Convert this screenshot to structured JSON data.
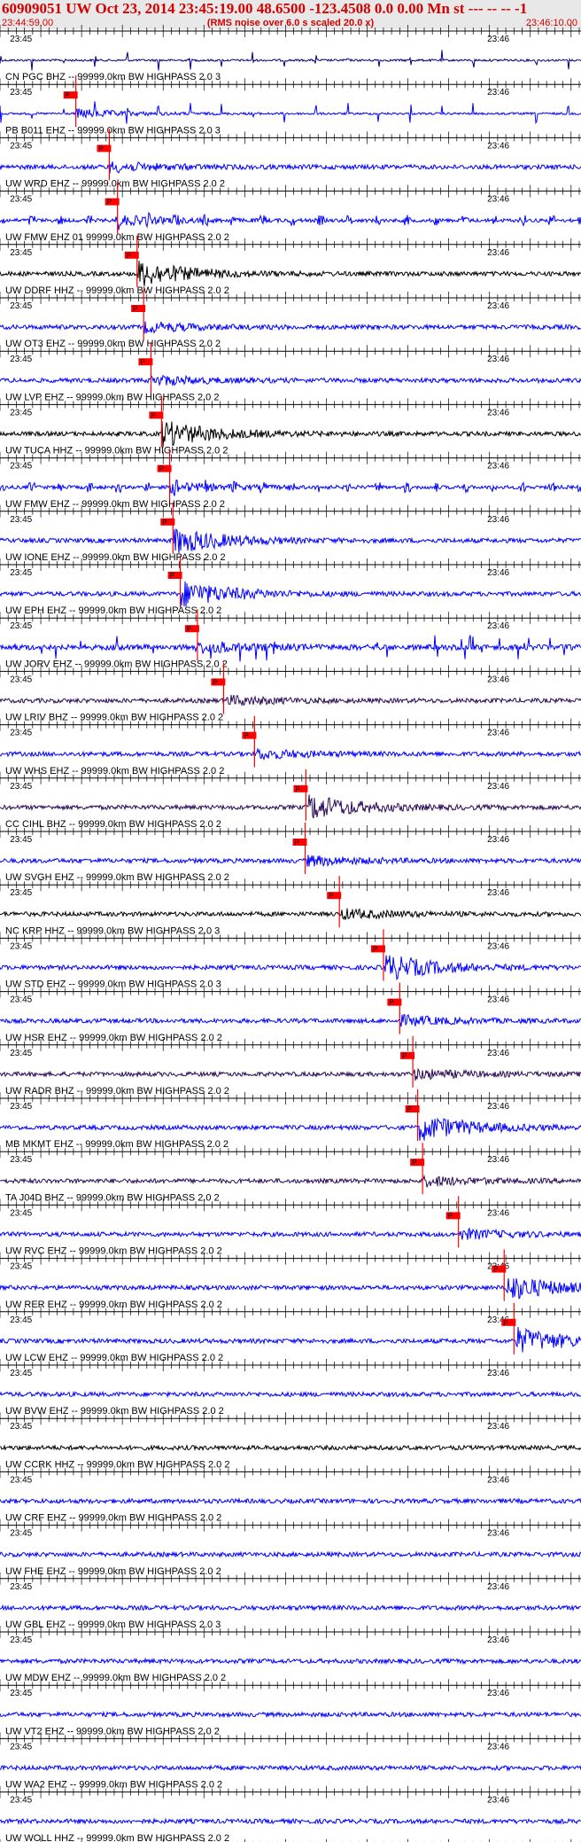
{
  "header": {
    "title": "60909051 UW Oct 23, 2014 23:45:19.00   48.6500 -123.4508  0.0 0.00 Mn st --- -- --   -1",
    "start_time": "23:44:59.00",
    "end_time": "23:46:10.00",
    "rms_note": "(RMS noise over 6.0 s scaled 20.0 x)"
  },
  "colors": {
    "title": "#d40000",
    "pick": "#ff0000",
    "blue_trace": "#0000ff",
    "black_trace": "#000000",
    "purple_trace": "#2a0a55"
  },
  "chart_data": {
    "type": "line",
    "time_range_s": [
      0,
      71
    ],
    "time_ticks": [
      "23:45",
      "23:46"
    ],
    "pick_label": "P",
    "traces": [
      {
        "label": "",
        "color": "#000080",
        "pick_s": null,
        "style": "pulse"
      },
      {
        "label": "CN PGC BHZ -- 99999.0km BW  HIGHPASS  2.0  3",
        "color": "#0000ff",
        "pick_s": 9.3,
        "style": "pulse"
      },
      {
        "label": "PB B011 EHZ -- 99999.0km BW  HIGHPASS  2.0  3",
        "color": "#0000ff",
        "pick_s": 13.4,
        "style": "noise"
      },
      {
        "label": "UW WRD EHZ -- 99999.0km BW  HIGHPASS  2.0  2",
        "color": "#0000ff",
        "pick_s": 14.4,
        "style": "bursts"
      },
      {
        "label": "UW FMW EHZ 01 99999.0km BW  HIGHPASS  2.0  2",
        "color": "#000000",
        "pick_s": 16.8,
        "style": "event"
      },
      {
        "label": "UW DDRF HHZ -- 99999.0km BW  HIGHPASS  2.0  2",
        "color": "#0000ff",
        "pick_s": 17.6,
        "style": "noise"
      },
      {
        "label": "UW OT3 EHZ -- 99999.0km BW  HIGHPASS  2.0  2",
        "color": "#0000ff",
        "pick_s": 18.5,
        "style": "noise"
      },
      {
        "label": "UW LVP EHZ -- 99999.0km BW  HIGHPASS  2.0  2",
        "color": "#000000",
        "pick_s": 19.8,
        "style": "event"
      },
      {
        "label": "UW TUCA HHZ -- 99999.0km BW  HIGHPASS  2.0  2",
        "color": "#0000ff",
        "pick_s": 20.8,
        "style": "bursts"
      },
      {
        "label": "UW FMW EHZ -- 99999.0km BW  HIGHPASS  2.0  2",
        "color": "#0000ff",
        "pick_s": 21.2,
        "style": "event"
      },
      {
        "label": "UW IONE EHZ -- 99999.0km BW  HIGHPASS  2.0  2",
        "color": "#0000ff",
        "pick_s": 22.1,
        "style": "event"
      },
      {
        "label": "UW EPH EHZ -- 99999.0km BW  HIGHPASS  2.0  2",
        "color": "#0000ff",
        "pick_s": 24.2,
        "style": "spiky"
      },
      {
        "label": "UW JORV EHZ -- 99999.0km BW  HIGHPASS  2.0  2",
        "color": "#2a0a55",
        "pick_s": 27.4,
        "style": "noise"
      },
      {
        "label": "UW LRIV BHZ -- 99999.0km BW  HIGHPASS  2.0  2",
        "color": "#0000ff",
        "pick_s": 31.2,
        "style": "noise"
      },
      {
        "label": "UW WHS EHZ -- 99999.0km BW  HIGHPASS  2.0  2",
        "color": "#2a0a55",
        "pick_s": 37.5,
        "style": "event"
      },
      {
        "label": "CC CIHL BHZ -- 99999.0km BW  HIGHPASS  2.0  2",
        "color": "#0000ff",
        "pick_s": 37.4,
        "style": "noise"
      },
      {
        "label": "UW SVGH EHZ -- 99999.0km BW  HIGHPASS  2.0  2",
        "color": "#000000",
        "pick_s": 41.6,
        "style": "noise"
      },
      {
        "label": "NC KRP HHZ -- 99999.0km BW  HIGHPASS  2.0  3",
        "color": "#0000ff",
        "pick_s": 47.0,
        "style": "event"
      },
      {
        "label": "UW STD EHZ -- 99999.0km BW  HIGHPASS  2.0  3",
        "color": "#0000ff",
        "pick_s": 49.0,
        "style": "noise"
      },
      {
        "label": "UW HSR EHZ -- 99999.0km BW  HIGHPASS  2.0  2",
        "color": "#2a0a55",
        "pick_s": 50.6,
        "style": "noise"
      },
      {
        "label": "UW RADR BHZ -- 99999.0km BW  HIGHPASS  2.0  2",
        "color": "#0000ff",
        "pick_s": 51.2,
        "style": "event"
      },
      {
        "label": "MB MKMT EHZ -- 99999.0km BW  HIGHPASS  2.0  2",
        "color": "#2a0a55",
        "pick_s": 51.8,
        "style": "noise"
      },
      {
        "label": "TA J04D BHZ -- 99999.0km BW  HIGHPASS  2.0  2",
        "color": "#0000ff",
        "pick_s": 56.2,
        "style": "noise"
      },
      {
        "label": "UW RVC EHZ -- 99999.0km BW  HIGHPASS  2.0  2",
        "color": "#0000ff",
        "pick_s": 61.8,
        "style": "event"
      },
      {
        "label": "UW RER EHZ -- 99999.0km BW  HIGHPASS  2.0  2",
        "color": "#0000ff",
        "pick_s": 63.0,
        "style": "event"
      },
      {
        "label": "UW LCW EHZ -- 99999.0km BW  HIGHPASS  2.0  2",
        "color": "#0000ff",
        "pick_s": null,
        "style": "noise"
      },
      {
        "label": "UW BVW EHZ -- 99999.0km BW  HIGHPASS  2.0  2",
        "color": "#000000",
        "pick_s": null,
        "style": "noise"
      },
      {
        "label": "UW CCRK HHZ -- 99999.0km BW  HIGHPASS  2.0  2",
        "color": "#0000ff",
        "pick_s": null,
        "style": "noise"
      },
      {
        "label": "UW CRF EHZ -- 99999.0km BW  HIGHPASS  2.0  2",
        "color": "#0000ff",
        "pick_s": null,
        "style": "noise"
      },
      {
        "label": "UW FHE EHZ -- 99999.0km BW  HIGHPASS  2.0  2",
        "color": "#0000ff",
        "pick_s": null,
        "style": "noise"
      },
      {
        "label": "UW GBL EHZ -- 99999.0km BW  HIGHPASS  2.0  3",
        "color": "#0000ff",
        "pick_s": null,
        "style": "noise"
      },
      {
        "label": "UW MDW EHZ -- 99999.0km BW  HIGHPASS  2.0  2",
        "color": "#0000ff",
        "pick_s": null,
        "style": "noise"
      },
      {
        "label": "UW VT2 EHZ -- 99999.0km BW  HIGHPASS  2.0  2",
        "color": "#0000ff",
        "pick_s": null,
        "style": "noise"
      },
      {
        "label": "UW WA2 EHZ -- 99999.0km BW  HIGHPASS  2.0  2",
        "color": "#0000ff",
        "pick_s": null,
        "style": "noise"
      },
      {
        "label": "UW WOLL HHZ -- 99999.0km BW  HIGHPASS  2.0  2",
        "color": "#000000",
        "pick_s": null,
        "style": "noise"
      }
    ]
  }
}
